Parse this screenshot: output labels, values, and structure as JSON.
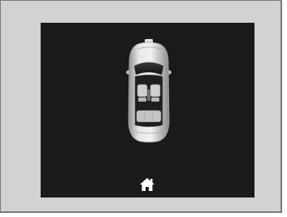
{
  "icons": {
    "car": "car-top-view-icon",
    "home": "home-icon"
  },
  "colors": {
    "frame_background": "#d2d2d2",
    "screen_background": "#1a1a1a",
    "car_body": "#c9c9c9",
    "icon": "#ffffff"
  }
}
